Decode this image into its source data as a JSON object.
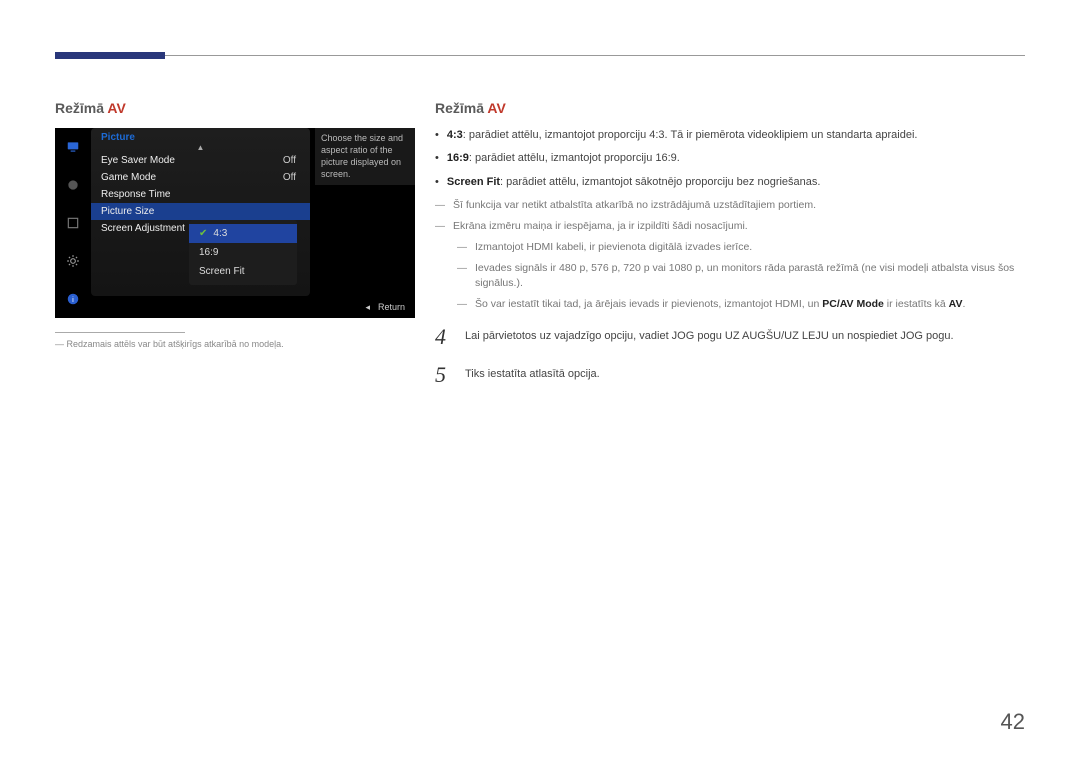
{
  "left": {
    "title_prefix": "Režīmā ",
    "title_suffix": "AV",
    "osd": {
      "panel_title": "Picture",
      "info_text": "Choose the size and aspect ratio of the picture displayed on screen.",
      "rows": [
        {
          "label": "Eye Saver Mode",
          "value": "Off"
        },
        {
          "label": "Game Mode",
          "value": "Off"
        },
        {
          "label": "Response Time",
          "value": ""
        },
        {
          "label": "Picture Size",
          "value": ""
        },
        {
          "label": "Screen Adjustment",
          "value": ""
        }
      ],
      "dropdown": [
        {
          "label": "4:3",
          "selected": true
        },
        {
          "label": "16:9",
          "selected": false
        },
        {
          "label": "Screen Fit",
          "selected": false
        }
      ],
      "return_label": "Return"
    },
    "footnote": "Redzamais attēls var būt atšķirīgs atkarībā no modeļa."
  },
  "right": {
    "title_prefix": "Režīmā ",
    "title_suffix": "AV",
    "bullets": [
      {
        "bold": "4:3",
        "text": ": parādiet attēlu, izmantojot proporciju 4:3. Tā ir piemērota videoklipiem un standarta apraidei."
      },
      {
        "bold": "16:9",
        "hl": true,
        "text": ": parādiet attēlu, izmantojot proporciju 16:9."
      },
      {
        "bold": "Screen Fit",
        "hl": true,
        "text": ": parādiet attēlu, izmantojot sākotnējo proporciju bez nogriešanas."
      }
    ],
    "dashes": [
      "Šī funkcija var netikt atbalstīta atkarībā no izstrādājumā uzstādītajiem portiem.",
      "Ekrāna izmēru maiņa ir iespējama, ja ir izpildīti šādi nosacījumi."
    ],
    "subdashes": [
      "Izmantojot HDMI kabeli, ir pievienota digitālā izvades ierīce.",
      "Ievades signāls ir 480 p, 576 p, 720 p vai 1080 p, un monitors rāda parastā režīmā (ne visi modeļi atbalsta visus šos signālus.)."
    ],
    "subdash_special_prefix": "Šo var iestatīt tikai tad, ja ārējais ievads ir pievienots, izmantojot HDMI, un ",
    "subdash_special_bold": "PC/AV Mode",
    "subdash_special_mid": " ir iestatīts kā ",
    "subdash_special_bold2": "AV",
    "subdash_special_end": ".",
    "steps": [
      {
        "num": "4",
        "text": "Lai pārvietotos uz vajadzīgo opciju, vadiet JOG pogu UZ AUGŠU/UZ LEJU un nospiediet JOG pogu."
      },
      {
        "num": "5",
        "text": "Tiks iestatīta atlasītā opcija."
      }
    ]
  },
  "page_number": "42"
}
